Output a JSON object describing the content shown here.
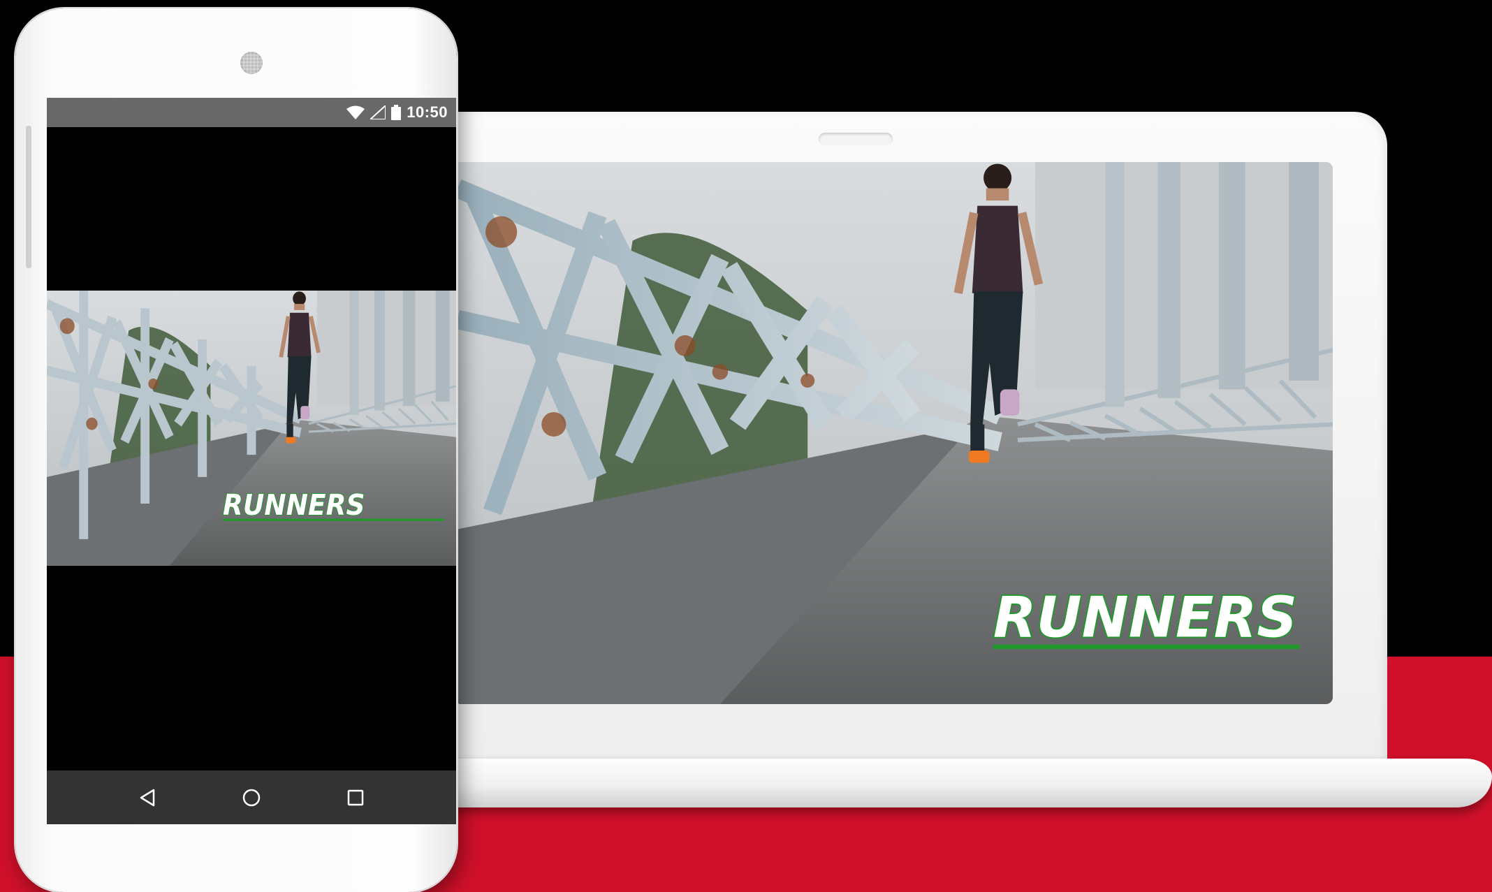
{
  "status_bar": {
    "time": "10:50",
    "icons": [
      "wifi-icon",
      "signal-icon",
      "battery-icon"
    ]
  },
  "navigation": {
    "buttons": [
      "back-icon",
      "home-icon",
      "recents-icon"
    ]
  },
  "video": {
    "overlay_text": "RUNNERS",
    "text_color": "#ffffff",
    "outline_color": "#1f9a2a"
  },
  "colors": {
    "background_top": "#000000",
    "background_bottom": "#d0102a",
    "device_body": "#f7f7f7",
    "status_bar": "#686868",
    "nav_bar": "#333333"
  }
}
